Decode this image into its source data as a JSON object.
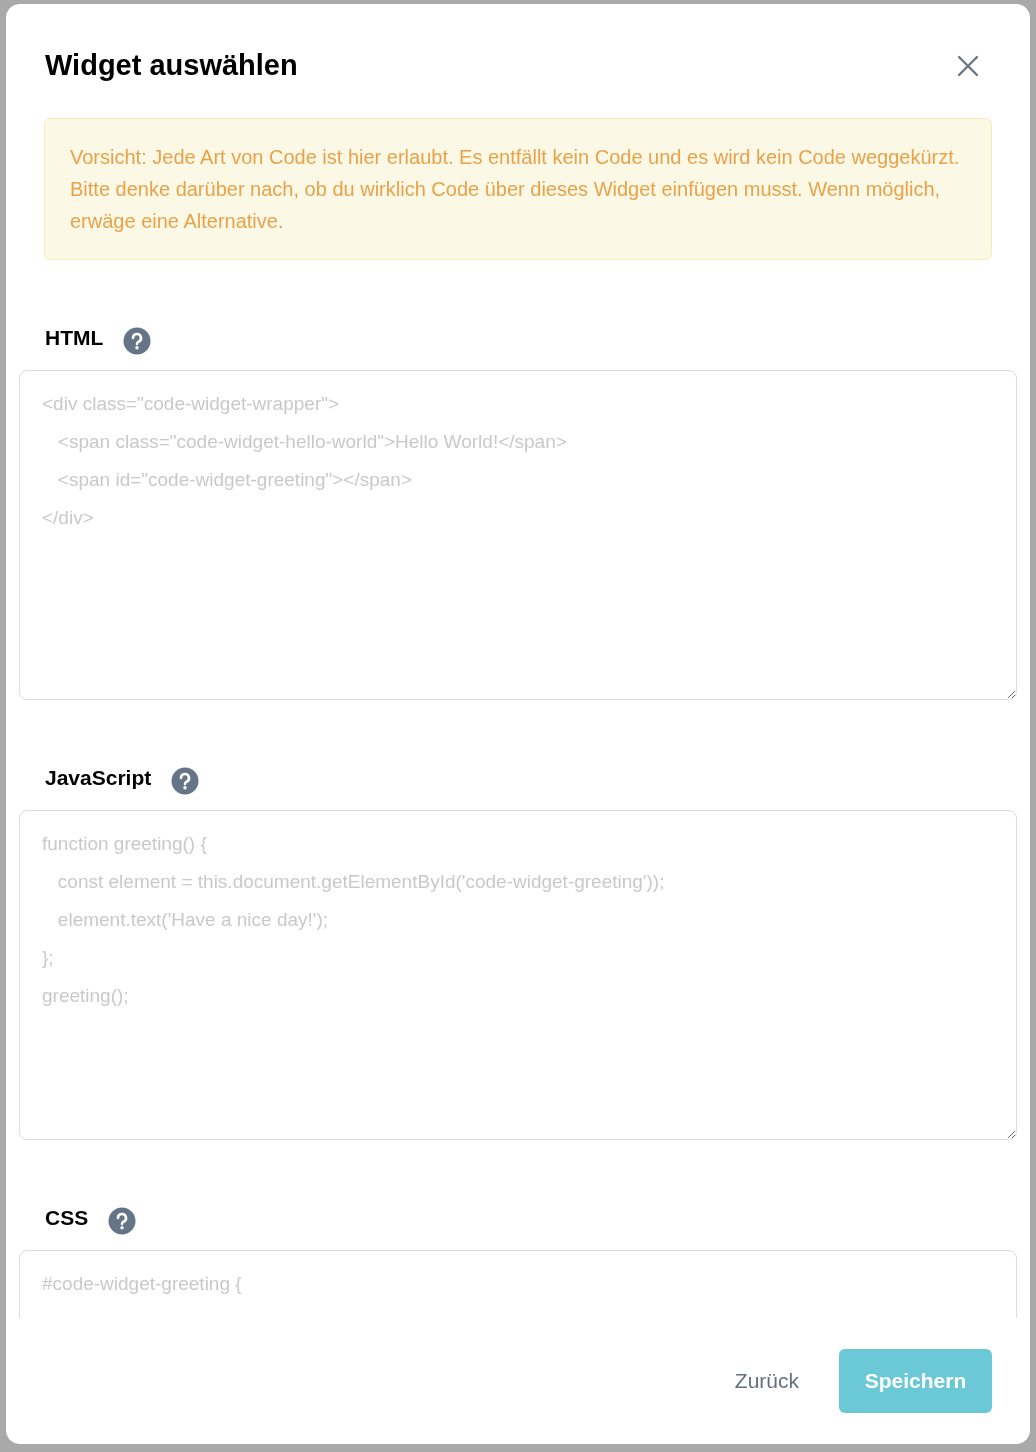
{
  "dialog": {
    "title": "Widget auswählen",
    "warning": "Vorsicht: Jede Art von Code ist hier erlaubt. Es entfällt kein Code und es wird kein Code weggekürzt. Bitte denke darüber nach, ob du wirklich Code über dieses Widget einfügen musst. Wenn möglich, erwäge eine Alternative.",
    "fields": [
      {
        "label": "HTML",
        "placeholder": "<div class=\"code-widget-wrapper\">\n   <span class=\"code-widget-hello-world\">Hello World!</span>\n   <span id=\"code-widget-greeting\"></span>\n</div>"
      },
      {
        "label": "JavaScript",
        "placeholder": "function greeting() {\n   const element = this.document.getElementById('code-widget-greeting'));\n   element.text('Have a nice day!');\n};\ngreeting();"
      },
      {
        "label": "CSS",
        "placeholder": "#code-widget-greeting {"
      }
    ],
    "buttons": [
      {
        "label": "Zurück",
        "kind": "secondary"
      },
      {
        "label": "Speichern",
        "kind": "primary"
      }
    ]
  }
}
